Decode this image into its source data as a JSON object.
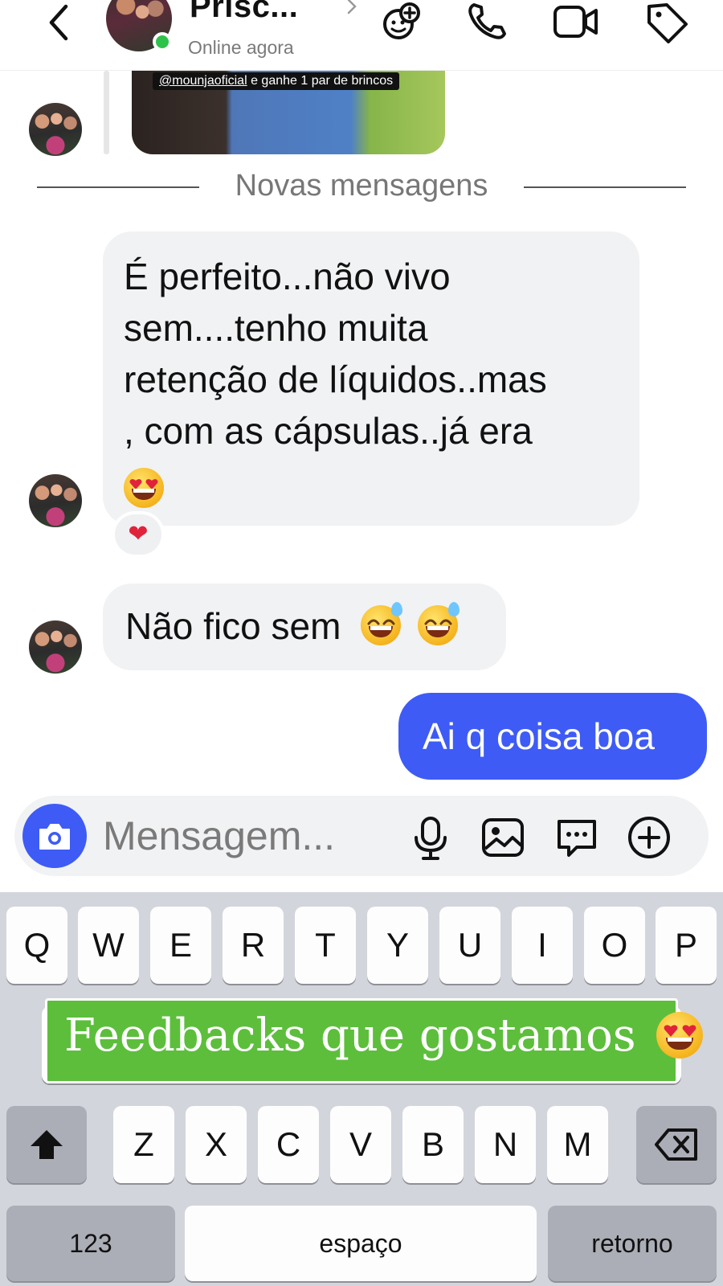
{
  "header": {
    "name": "Prisc...",
    "status": "Online agora"
  },
  "story": {
    "mention": "@mounjaoficial",
    "caption_rest": " e ganhe 1 par de brincos"
  },
  "divider": {
    "label": "Novas mensagens"
  },
  "messages": [
    {
      "direction": "incoming",
      "lines": [
        "É perfeito...não vivo",
        "sem....tenho muita",
        "retenção de líquidos..mas",
        ", com as cápsulas..já era"
      ],
      "emoji": "heart-eyes",
      "reaction": "❤"
    },
    {
      "direction": "incoming",
      "text": "Não fico sem",
      "emoji": [
        "sweat-smile",
        "sweat-smile"
      ]
    },
    {
      "direction": "outgoing",
      "text": "Ai q coisa boa"
    }
  ],
  "composer": {
    "placeholder": "Mensagem..."
  },
  "keyboard": {
    "row1": [
      "Q",
      "W",
      "E",
      "R",
      "T",
      "Y",
      "U",
      "I",
      "O",
      "P"
    ],
    "row3": [
      "Z",
      "X",
      "C",
      "V",
      "B",
      "N",
      "M"
    ],
    "numbers_label": "123",
    "space_label": "espaço",
    "return_label": "retorno"
  },
  "overlay": {
    "text": "Feedbacks que gostamos"
  },
  "colors": {
    "accent": "#3e5bf6",
    "online": "#2ec24b",
    "banner": "#5dbe3c",
    "bubble_in": "#f1f2f4"
  },
  "icons": [
    "back-chevron-icon",
    "add-effect-icon",
    "phone-icon",
    "video-icon",
    "tag-icon",
    "camera-icon",
    "microphone-icon",
    "gallery-icon",
    "sticker-icon",
    "plus-icon",
    "shift-icon",
    "backspace-icon"
  ]
}
